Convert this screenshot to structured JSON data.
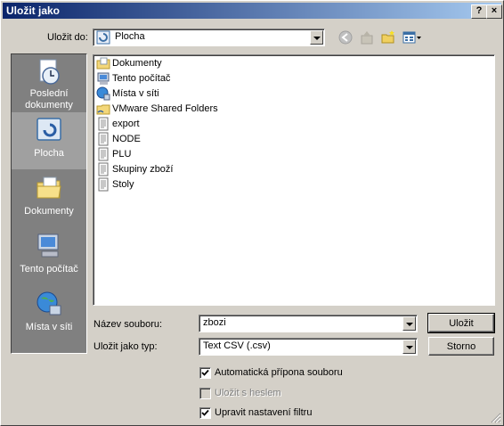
{
  "window": {
    "title": "Uložit jako",
    "help_label": "?",
    "close_label": "×"
  },
  "savein": {
    "label": "Uložit do:",
    "value": "Plocha"
  },
  "toolbar": {
    "back_icon": "back-arrow-icon",
    "up_icon": "up-folder-icon",
    "newfolder_icon": "new-folder-icon",
    "view_icon": "view-menu-icon"
  },
  "places": [
    {
      "label1": "Poslední",
      "label2": "dokumenty",
      "icon": "recent-documents-icon"
    },
    {
      "label1": "Plocha",
      "label2": "",
      "icon": "desktop-icon"
    },
    {
      "label1": "Dokumenty",
      "label2": "",
      "icon": "documents-folder-icon"
    },
    {
      "label1": "Tento počítač",
      "label2": "",
      "icon": "my-computer-icon"
    },
    {
      "label1": "Místa v síti",
      "label2": "",
      "icon": "network-places-icon"
    }
  ],
  "files": [
    {
      "name": "Dokumenty",
      "icon": "documents-folder-icon"
    },
    {
      "name": "Tento počítač",
      "icon": "my-computer-icon"
    },
    {
      "name": "Místa v síti",
      "icon": "network-places-icon"
    },
    {
      "name": "VMware Shared Folders",
      "icon": "shared-folder-icon"
    },
    {
      "name": "export",
      "icon": "text-file-icon"
    },
    {
      "name": "NODE",
      "icon": "text-file-icon"
    },
    {
      "name": "PLU",
      "icon": "text-file-icon"
    },
    {
      "name": "Skupiny zboží",
      "icon": "text-file-icon"
    },
    {
      "name": "Stoly",
      "icon": "text-file-icon"
    }
  ],
  "filename": {
    "label": "Název souboru:",
    "value": "zbozi"
  },
  "filetype": {
    "label": "Uložit jako typ:",
    "value": "Text CSV (.csv)"
  },
  "buttons": {
    "save": "Uložit",
    "cancel": "Storno"
  },
  "options": [
    {
      "label": "Automatická přípona souboru",
      "checked": true,
      "enabled": true
    },
    {
      "label": "Uložit s heslem",
      "checked": false,
      "enabled": false
    },
    {
      "label": "Upravit nastavení filtru",
      "checked": true,
      "enabled": true
    }
  ],
  "colors": {
    "title_start": "#0a246a",
    "title_end": "#a6caf0",
    "face": "#d4d0c8",
    "places_bg": "#808080"
  }
}
